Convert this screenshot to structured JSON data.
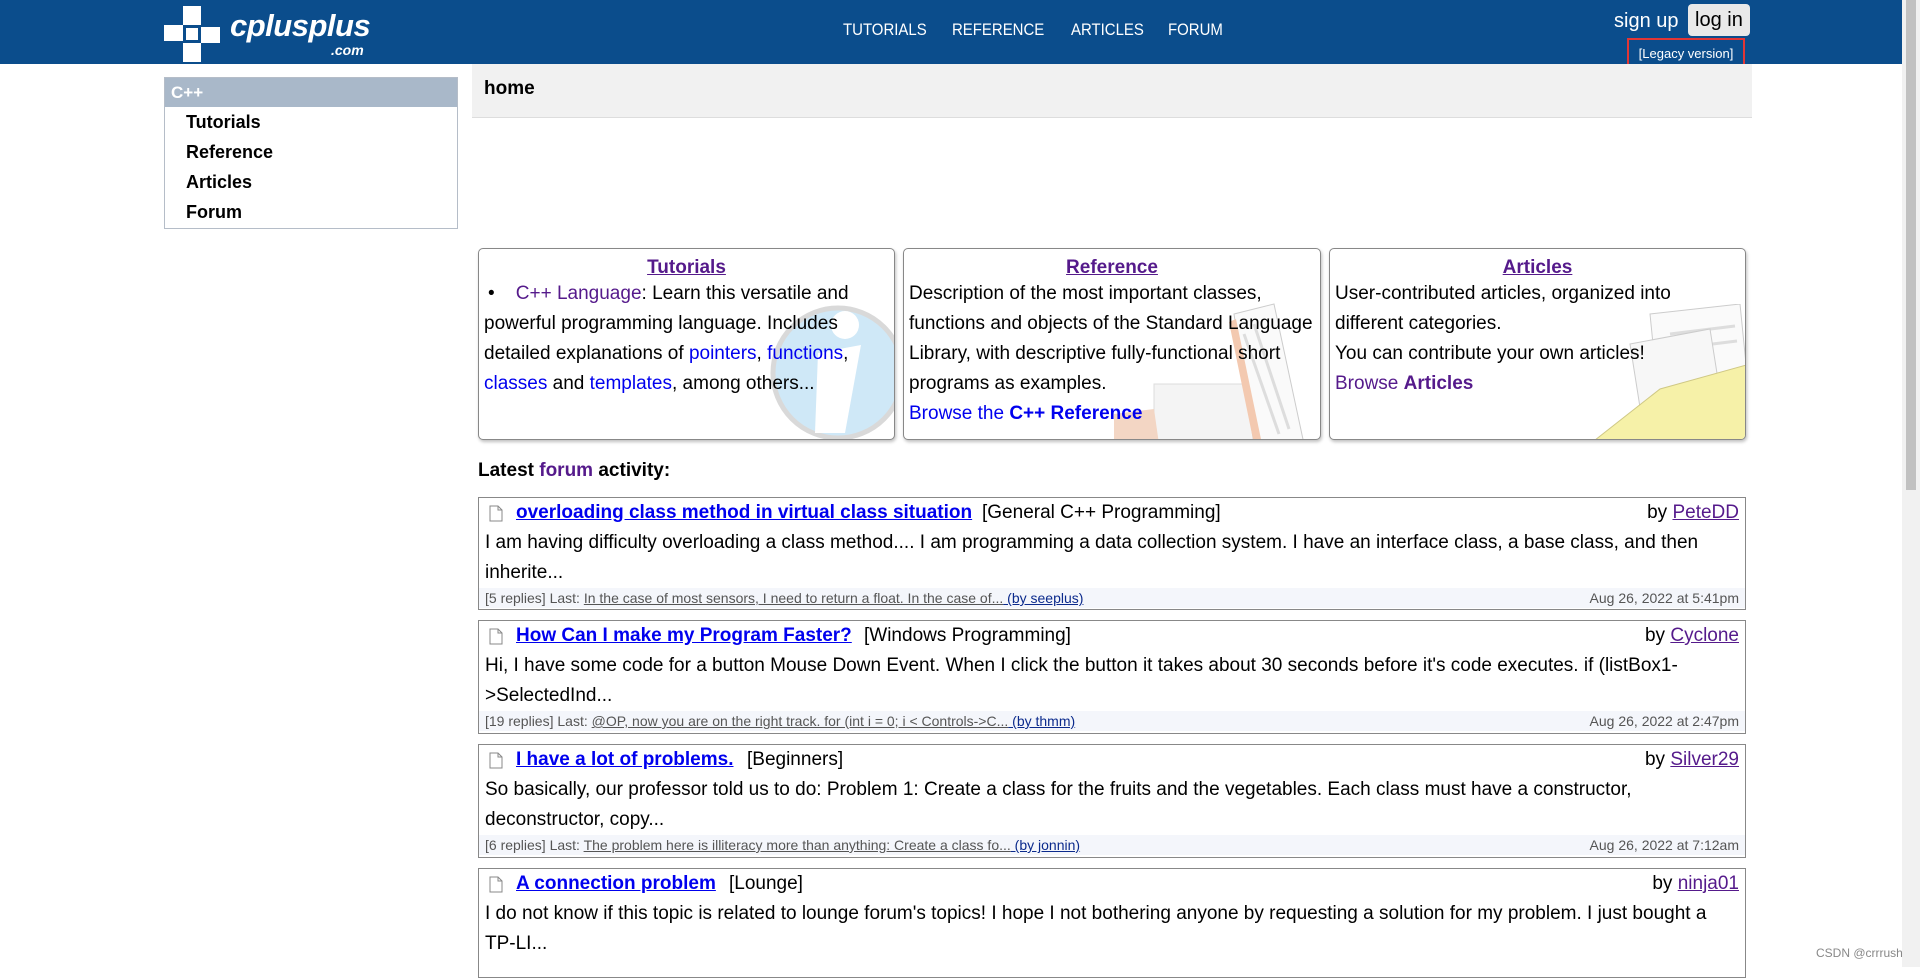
{
  "header": {
    "logo_text": "cplusplus",
    "logo_sub": ".com",
    "nav": [
      "TUTORIALS",
      "REFERENCE",
      "ARTICLES",
      "FORUM"
    ],
    "signup": "sign up",
    "login": "log in",
    "legacy": "[Legacy version]"
  },
  "sidebar": {
    "heading": "C++",
    "items": [
      "Tutorials",
      "Reference",
      "Articles",
      "Forum"
    ]
  },
  "home_title": "home",
  "cards": {
    "tutorials": {
      "title": "Tutorials",
      "link": "C++ Language",
      "text1": ": Learn this versatile and powerful programming language. Includes detailed explanations of ",
      "l_pointers": "pointers",
      "l_functions": "functions",
      "l_classes": "classes",
      "l_templates": "templates",
      "sep1": ", ",
      "sep2": ",",
      "and": " and ",
      "end": ", among others..."
    },
    "reference": {
      "title": "Reference",
      "text": "Description of the most important classes, functions and objects of the Standard Language Library, with descriptive fully-functional short programs as examples.",
      "browse_pre": "Browse the ",
      "browse_bold": "C++ Reference"
    },
    "articles": {
      "title": "Articles",
      "text1": "User-contributed articles, organized into different categories.",
      "text2": "You can contribute your own articles!",
      "browse_pre": "Browse ",
      "browse_bold": "Articles"
    }
  },
  "latest": {
    "pre": "Latest ",
    "link": "forum",
    "post": " activity:"
  },
  "posts": [
    {
      "title": "overloading class method in virtual class situation",
      "category": "[General C++ Programming]",
      "by_label": "by ",
      "author": "PeteDD",
      "text": "I am having difficulty overloading a class method.... I am programming a data collection system. I have an interface class, a base class, and then inherite...",
      "replies": "[5 replies] Last: ",
      "last": "In the case of most sensors, I need to return a float. In the case of...",
      "last_by": " (by seeplus)",
      "date": "Aug 26, 2022 at 5:41pm"
    },
    {
      "title": "How Can I make my Program Faster?",
      "category": "[Windows Programming]",
      "by_label": "by ",
      "author": "Cyclone",
      "text": "Hi, I have some code for a button Mouse Down Event. When I click the button it takes about 30 seconds before it's code executes. if (listBox1->SelectedInd...",
      "replies": "[19 replies] Last: ",
      "last": "@OP, now you are on the right track. for (int i = 0; i < Controls->C...",
      "last_by": " (by thmm)",
      "date": "Aug 26, 2022 at 2:47pm"
    },
    {
      "title": "I have a lot of problems.",
      "category": "[Beginners]",
      "by_label": "by ",
      "author": "Silver29",
      "text": "So basically, our professor told us to do: Problem 1: Create a class for the fruits and the vegetables. Each class must have a constructor, deconstructor, copy...",
      "replies": "[6 replies] Last: ",
      "last": "The problem here is illiteracy more than anything: Create a class fo...",
      "last_by": " (by jonnin)",
      "date": "Aug 26, 2022 at 7:12am"
    },
    {
      "title": "A connection problem",
      "category": "[Lounge]",
      "by_label": "by ",
      "author": "ninja01",
      "text": "I do not know if this topic is related to lounge forum's topics! I hope I not bothering anyone by requesting a solution for my problem. I just bought a TP-LI...",
      "replies": "",
      "last": "",
      "last_by": "",
      "date": ""
    }
  ],
  "watermark_csdn": "CSDN @crrrush"
}
